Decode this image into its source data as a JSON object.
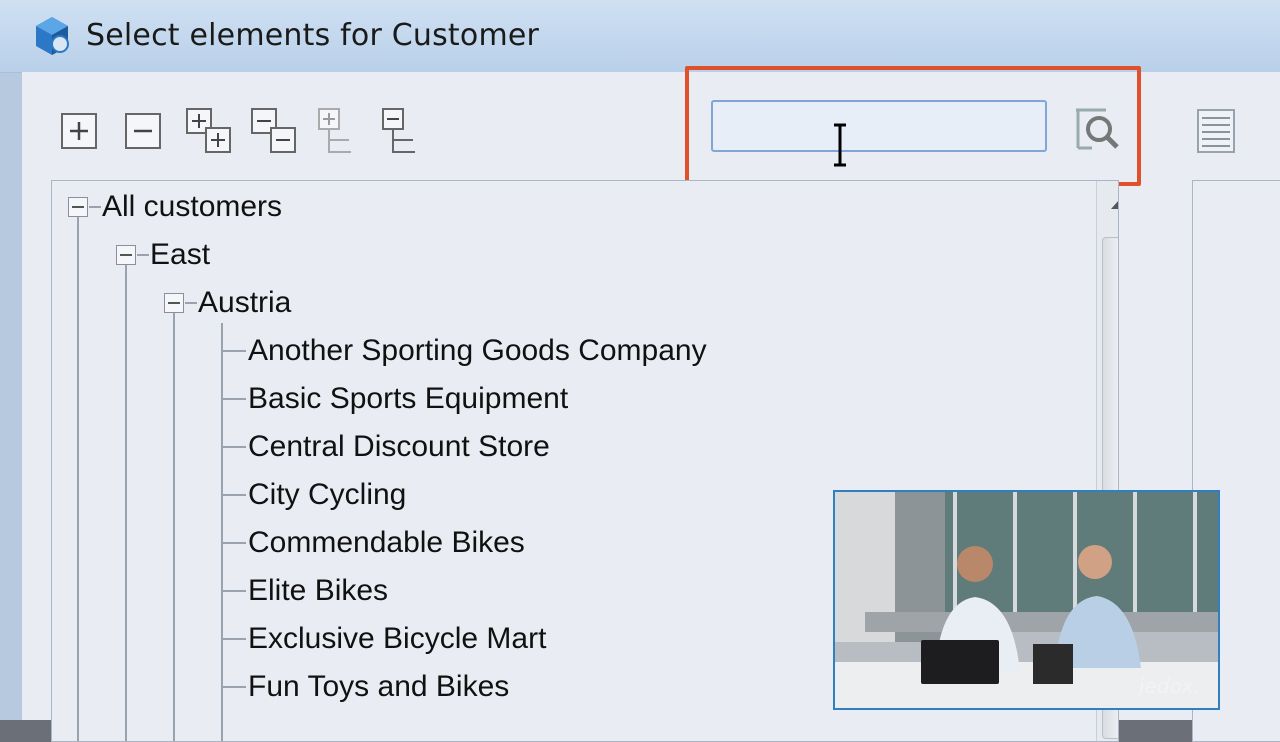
{
  "window": {
    "title": "Select elements for Customer"
  },
  "toolbar": {
    "buttons": [
      {
        "name": "expand-icon"
      },
      {
        "name": "collapse-icon"
      },
      {
        "name": "expand-all-icon"
      },
      {
        "name": "collapse-all-icon"
      },
      {
        "name": "expand-level-icon"
      },
      {
        "name": "collapse-level-icon"
      }
    ]
  },
  "search": {
    "value": ""
  },
  "tree": {
    "root": "All customers",
    "region": "East",
    "country": "Austria",
    "customers": [
      "Another Sporting Goods Company",
      "Basic Sports Equipment",
      "Central Discount Store",
      "City Cycling",
      "Commendable Bikes",
      "Elite Bikes",
      "Exclusive Bicycle Mart",
      "Fun Toys and Bikes"
    ]
  },
  "video": {
    "watermark": "jedox."
  },
  "colors": {
    "highlight": "#e0502a",
    "accent": "#2f7fc1"
  }
}
